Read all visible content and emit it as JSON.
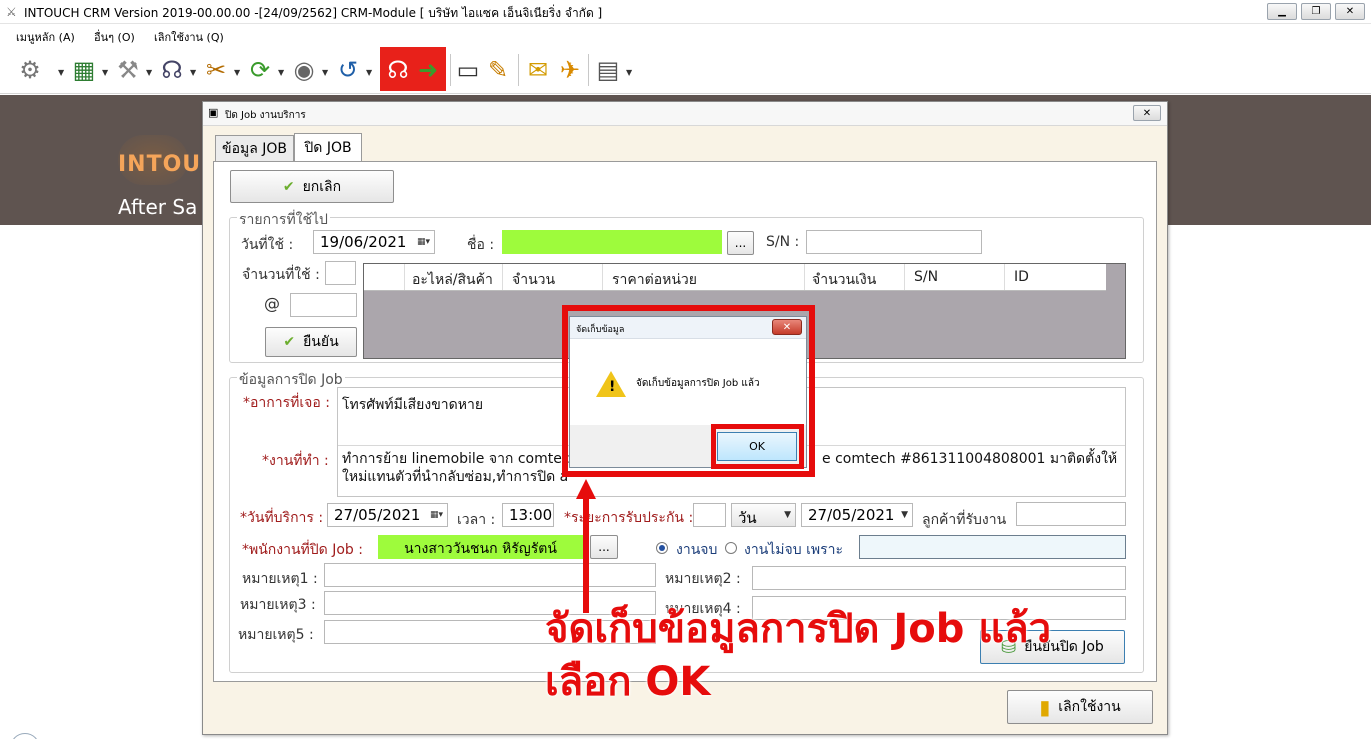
{
  "window": {
    "title": "INTOUCH CRM Version 2019-00.00.00 -[24/09/2562] CRM-Module  [ บริษัท ไอแซค เอ็นจิเนียริ่ง จำกัด ]",
    "min_icon": "minimize-icon",
    "max_icon": "restore-icon",
    "close_icon": "close-icon"
  },
  "menu": {
    "items": [
      "เมนูหลัก (A)",
      "อื่นๆ (O)",
      "เลิกใช้งาน (Q)"
    ]
  },
  "toolbar": {
    "icons": [
      "gear-icon",
      "table-icon",
      "tools-icon",
      "headset-icon",
      "wrench-icon",
      "refresh-green-icon",
      "eye-icon",
      "undo-icon",
      "headset-red-icon",
      "arrow-green-icon",
      "monitor-icon",
      "note-edit-icon",
      "mail-icon",
      "pin-icon",
      "report-icon"
    ],
    "highlight_color": "#e8211a"
  },
  "banner": {
    "brand": "INTOU",
    "subtitle": "After Sa"
  },
  "dialog": {
    "title": "ปิด Job งานบริการ",
    "tabs": [
      "ข้อมูล JOB",
      "ปิด JOB"
    ],
    "active_tab": "ปิด JOB",
    "cancel_label": "ยกเลิก",
    "parts_group": {
      "legend": "รายการที่ใช้ไป",
      "date_label": "วันที่ใช้ :",
      "date_value": "19/06/2021",
      "name_label": "ชื่อ :",
      "name_button": "...",
      "sn_label": "S/N :",
      "qty_label": "จำนวนที่ใช้ :",
      "at_label": "@",
      "confirm_label": "ยืนยัน",
      "grid_columns": [
        "อะไหล่/สินค้า",
        "จำนวน",
        "ราคาต่อหน่วย",
        "จำนวนเงิน",
        "S/N",
        "ID"
      ]
    },
    "close_group": {
      "legend": "ข้อมูลการปิด Job",
      "symptom_label": "*อาการที่เจอ :",
      "symptom_value": "โทรศัพท์มีเสียงขาดหาย",
      "work_label": "*งานที่ทำ :",
      "work_line1_left": "ทำการย้าย linemobile จาก comtec",
      "work_line1_right": "e comtech #861311004808001 มาติดตั้งให้",
      "work_line2": "ใหม่แทนตัวที่นำกลับซ่อม,ทำการปิด a",
      "service_date_label": "*วันที่บริการ :",
      "service_date_value": "27/05/2021",
      "time_label": "เวลา :",
      "time_value": "13:00",
      "warranty_label": "*ระยะการรับประกัน :",
      "warranty_unit": "วัน",
      "warranty_date": "27/05/2021",
      "customer_label": "ลูกค้าที่รับงาน",
      "staff_label": "*พนักงานที่ปิด Job :",
      "staff_value": "นางสาววันชนก หิรัญรัตน์",
      "staff_button": "...",
      "radio_done": "งานจบ",
      "radio_notdone": "งานไม่จบ เพราะ",
      "note1_label": "หมายเหตุ1 :",
      "note2_label": "หมายเหตุ2 :",
      "note3_label": "หมายเหตุ3 :",
      "note4_label": "หมายเหตุ4 :",
      "note5_label": "หมายเหตุ5 :",
      "confirm_close_label": "ยืนยันปิด Job"
    },
    "exit_label": "เลิกใช้งาน"
  },
  "msgbox": {
    "title": "จัดเก็บข้อมูล",
    "message": "จัดเก็บข้อมูลการปิด Job แล้ว",
    "ok_label": "OK",
    "icon": "warning-icon"
  },
  "annotation": {
    "line1": "จัดเก็บข้อมูลการปิด Job แล้ว",
    "line2": "เลือก OK",
    "color": "#e60c0c"
  }
}
